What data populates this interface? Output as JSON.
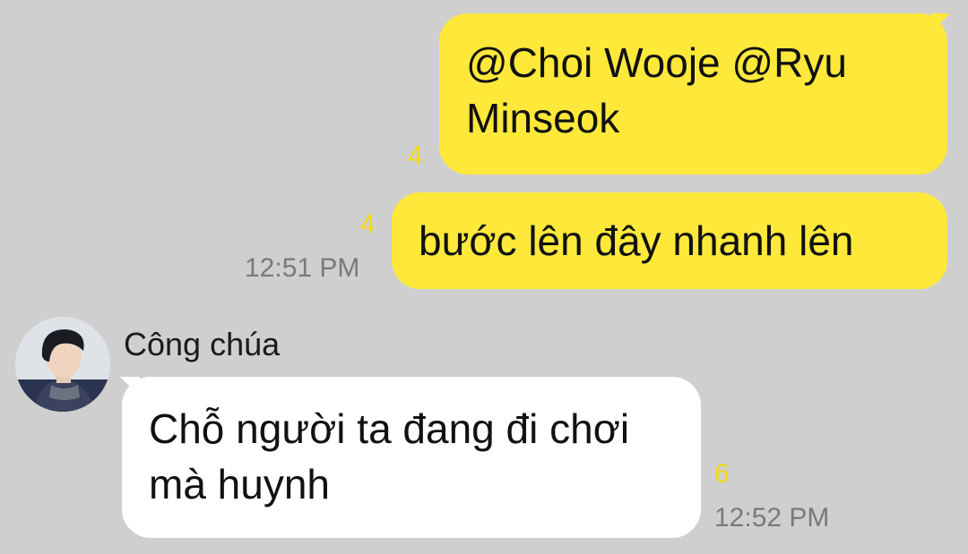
{
  "messages": [
    {
      "direction": "outgoing",
      "text": "@Choi Wooje @Ryu Minseok",
      "unread": "4"
    },
    {
      "direction": "outgoing",
      "text": "bước lên đây nhanh lên",
      "unread": "4",
      "time": "12:51 PM"
    },
    {
      "direction": "incoming",
      "sender": "Công chúa",
      "text": "Chỗ người ta đang đi chơi mà huynh",
      "unread": "6",
      "time": "12:52 PM"
    }
  ],
  "colors": {
    "background": "#cfcfcf",
    "outgoing_bubble": "#fee93a",
    "incoming_bubble": "#ffffff",
    "unread_count": "#f5d90a",
    "timestamp": "#7a7a7a"
  },
  "icons": {
    "avatar": "profile-photo-avatar"
  }
}
